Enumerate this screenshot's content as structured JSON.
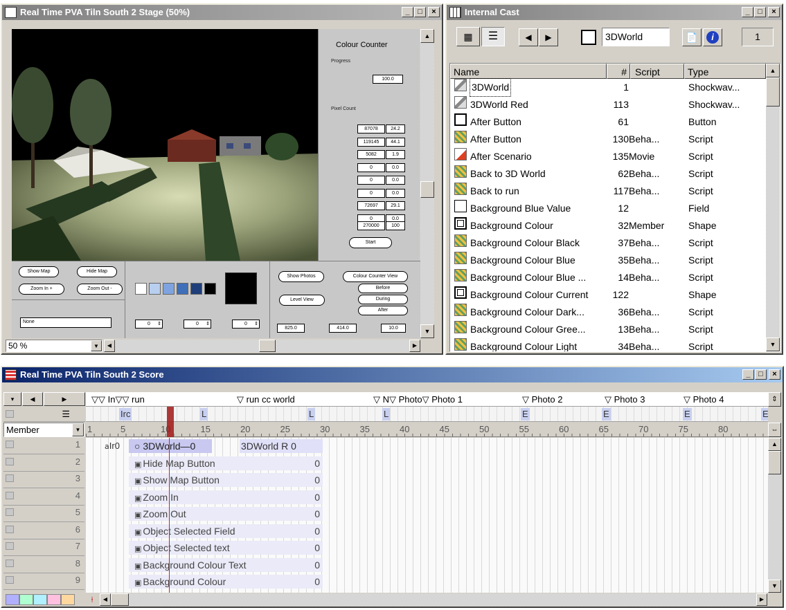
{
  "stage": {
    "title": "Real Time PVA Tiln South 2 Stage (50%)",
    "zoom": "50 %",
    "panel": {
      "heading": "Colour Counter",
      "progress_label": "Progress",
      "progress_value": "100.0",
      "pixel_count_label": "Pixel Count",
      "rows": [
        [
          "87078",
          "24.2"
        ],
        [
          "119145",
          "44.1"
        ],
        [
          "5082",
          "1.9"
        ],
        [
          "0",
          "0.0"
        ],
        [
          "0",
          "0.0"
        ],
        [
          "0",
          "0.0"
        ],
        [
          "72697",
          "29.1"
        ],
        [
          "0",
          "0.0"
        ]
      ],
      "total": [
        "270000",
        "100"
      ],
      "start_label": "Start"
    },
    "buttons": {
      "show_map": "Show Map",
      "hide_map": "Hide Map",
      "zoom_in": "Zoom In +",
      "zoom_out": "Zoom Out -",
      "show_photos": "Show Photos",
      "colour_counter_view": "Colour Counter View",
      "level_view": "Level View",
      "before": "Before",
      "during": "During",
      "after": "After"
    },
    "selected_field": "None",
    "swatch_colors": [
      "#ffffff",
      "#b8cff0",
      "#7fa3e0",
      "#3f6fb8",
      "#1f3f7a",
      "#000000"
    ],
    "steppers": [
      "0",
      "0",
      "0"
    ],
    "coords": [
      "825.0",
      "414.0",
      "10.0"
    ]
  },
  "cast": {
    "title": "Internal Cast",
    "member_name": "3DWorld",
    "member_number": "1",
    "columns": [
      "Name",
      "#",
      "Script",
      "Type"
    ],
    "rows": [
      {
        "name": "3DWorld",
        "num": "1",
        "script": "",
        "type": "Shockwav...",
        "icon": "shockwave-icon"
      },
      {
        "name": "3DWorld Red",
        "num": "113",
        "script": "",
        "type": "Shockwav...",
        "icon": "shockwave-icon"
      },
      {
        "name": "After Button",
        "num": "61",
        "script": "",
        "type": "Button",
        "icon": "button-icon"
      },
      {
        "name": "After Button",
        "num": "130",
        "script": "Beha...",
        "type": "Script",
        "icon": "behavior-icon"
      },
      {
        "name": "After Scenario",
        "num": "135",
        "script": "Movie",
        "type": "Script",
        "icon": "movie-script-icon"
      },
      {
        "name": "Back to 3D World",
        "num": "62",
        "script": "Beha...",
        "type": "Script",
        "icon": "behavior-icon"
      },
      {
        "name": "Back to run",
        "num": "117",
        "script": "Beha...",
        "type": "Script",
        "icon": "behavior-icon"
      },
      {
        "name": "Background Blue Value",
        "num": "12",
        "script": "",
        "type": "Field",
        "icon": "field-icon"
      },
      {
        "name": "Background Colour",
        "num": "32",
        "script": "Member",
        "type": "Shape",
        "icon": "shape-icon"
      },
      {
        "name": "Background Colour Black",
        "num": "37",
        "script": "Beha...",
        "type": "Script",
        "icon": "behavior-icon"
      },
      {
        "name": "Background Colour Blue",
        "num": "35",
        "script": "Beha...",
        "type": "Script",
        "icon": "behavior-icon"
      },
      {
        "name": "Background Colour Blue ...",
        "num": "14",
        "script": "Beha...",
        "type": "Script",
        "icon": "behavior-icon"
      },
      {
        "name": "Background Colour Current",
        "num": "122",
        "script": "",
        "type": "Shape",
        "icon": "shape-icon"
      },
      {
        "name": "Background Colour Dark...",
        "num": "36",
        "script": "Beha...",
        "type": "Script",
        "icon": "behavior-icon"
      },
      {
        "name": "Background Colour Gree...",
        "num": "13",
        "script": "Beha...",
        "type": "Script",
        "icon": "behavior-icon"
      },
      {
        "name": "Background Colour Light",
        "num": "34",
        "script": "Beha...",
        "type": "Script",
        "icon": "behavior-icon"
      }
    ]
  },
  "score": {
    "title": "Real Time PVA Tiln South 2 Score",
    "markers": [
      "▽▽ In▽▽ run",
      "▽ run cc world",
      "▽ N▽ Photo▽ Photo 1",
      "▽ Photo 2",
      "▽ Photo 3",
      "▽ Photo 4"
    ],
    "script_channel": [
      "Irc",
      "L",
      "L",
      "L",
      "E",
      "E",
      "E",
      "E"
    ],
    "display_mode": "Member",
    "frame_numbers": [
      "1",
      "5",
      "10",
      "15",
      "20",
      "25",
      "30",
      "35",
      "40",
      "45",
      "50",
      "55",
      "60",
      "65",
      "70",
      "75",
      "80"
    ],
    "channels": [
      "1",
      "2",
      "3",
      "4",
      "5",
      "6",
      "7",
      "8",
      "9"
    ],
    "sprite_label_a": "Ir0",
    "sprite_label_b": "○ 3DWorld—0",
    "sprite_label_c": "3DWorld R 0",
    "sprites": [
      "Hide Map Button",
      "Show Map Button",
      "Zoom In",
      "Zoom Out",
      "Object Selected Field",
      "Object Selected text",
      "Background Colour Text",
      "Background Colour"
    ],
    "sprite_end": "0"
  }
}
